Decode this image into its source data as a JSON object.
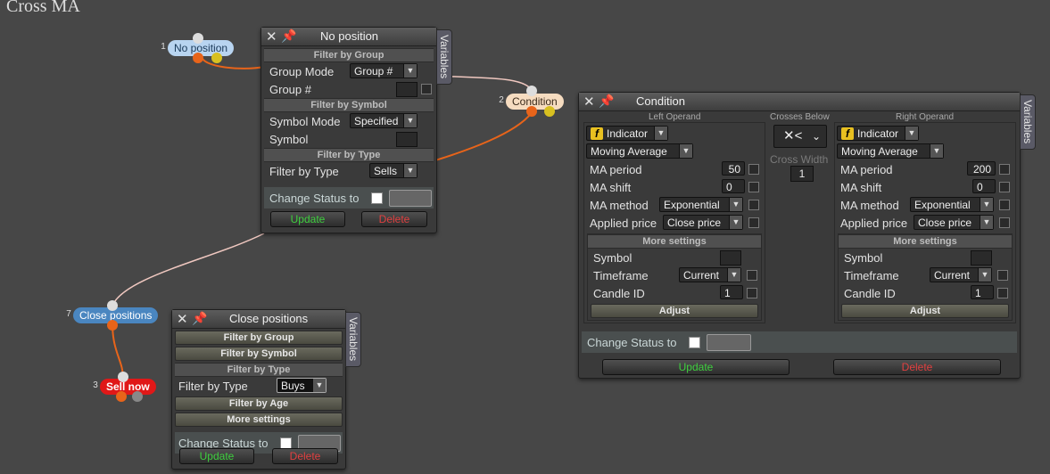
{
  "canvas": {
    "title": "Cross MA"
  },
  "nodes": {
    "no_position": {
      "num": "1",
      "label": "No position"
    },
    "condition": {
      "num": "2",
      "label": "Condition"
    },
    "close_positions": {
      "num": "7",
      "label": "Close positions"
    },
    "sell_now": {
      "num": "3",
      "label": "Sell now"
    }
  },
  "panel_no_position": {
    "title": "No position",
    "variables_tab": "Variables",
    "filter_by_group": "Filter by Group",
    "group_mode_label": "Group Mode",
    "group_mode_value": "Group #",
    "group_num_label": "Group #",
    "filter_by_symbol": "Filter by Symbol",
    "symbol_mode_label": "Symbol Mode",
    "symbol_mode_value": "Specified",
    "symbol_label": "Symbol",
    "filter_by_type": "Filter by Type",
    "filter_type_label": "Filter by Type",
    "filter_type_value": "Sells",
    "change_status": "Change Status to",
    "update": "Update",
    "delete": "Delete"
  },
  "panel_condition": {
    "title": "Condition",
    "variables_tab": "Variables",
    "left_operand": "Left Operand",
    "crosses_below": "Crosses Below",
    "right_operand": "Right Operand",
    "cross_symbol": "✕<",
    "cross_width_label": "Cross Width",
    "cross_width_value": "1",
    "left": {
      "indicator": "Indicator",
      "indicator_type": "Moving Average",
      "ma_period_label": "MA period",
      "ma_period": "50",
      "ma_shift_label": "MA shift",
      "ma_shift": "0",
      "ma_method_label": "MA method",
      "ma_method": "Exponential",
      "applied_price_label": "Applied price",
      "applied_price": "Close price",
      "more_settings": "More settings",
      "symbol_label": "Symbol",
      "timeframe_label": "Timeframe",
      "timeframe": "Current",
      "candle_id_label": "Candle ID",
      "candle_id": "1",
      "adjust": "Adjust"
    },
    "right": {
      "indicator": "Indicator",
      "indicator_type": "Moving Average",
      "ma_period_label": "MA period",
      "ma_period": "200",
      "ma_shift_label": "MA shift",
      "ma_shift": "0",
      "ma_method_label": "MA method",
      "ma_method": "Exponential",
      "applied_price_label": "Applied price",
      "applied_price": "Close price",
      "more_settings": "More settings",
      "symbol_label": "Symbol",
      "timeframe_label": "Timeframe",
      "timeframe": "Current",
      "candle_id_label": "Candle ID",
      "candle_id": "1",
      "adjust": "Adjust"
    },
    "change_status": "Change Status to",
    "update": "Update",
    "delete": "Delete"
  },
  "panel_close": {
    "title": "Close positions",
    "variables_tab": "Variables",
    "filter_by_group": "Filter by Group",
    "filter_by_symbol": "Filter by Symbol",
    "filter_by_type": "Filter by Type",
    "filter_type_label": "Filter by Type",
    "filter_type_value": "Buys",
    "filter_by_age": "Filter by Age",
    "more_settings": "More settings",
    "change_status": "Change Status to",
    "update": "Update",
    "delete": "Delete"
  },
  "colors": {
    "accent_orange": "#e8641a",
    "update_green": "#3fcf3f",
    "delete_red": "#e04040",
    "wire_pink": "#f0c8c0"
  }
}
